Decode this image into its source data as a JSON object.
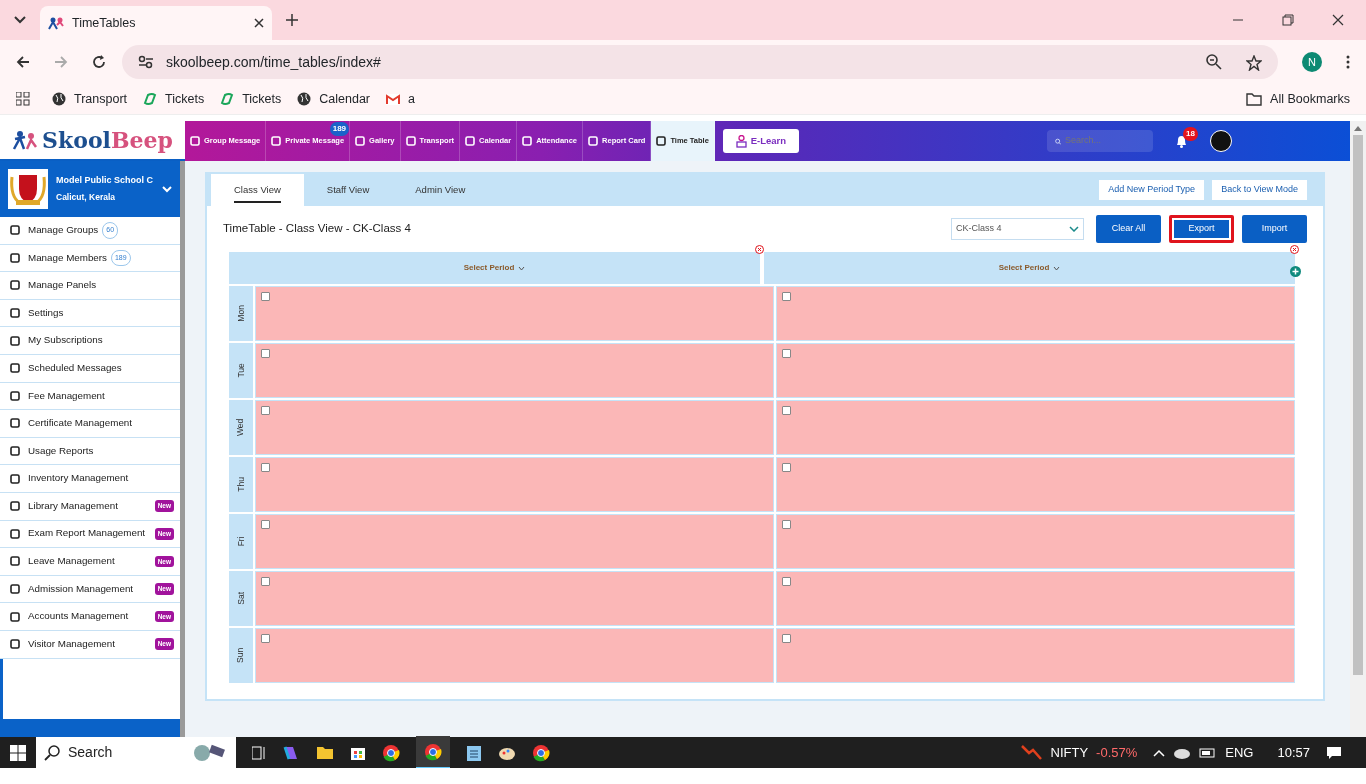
{
  "browser": {
    "tab_title": "TimeTables",
    "url": "skoolbeep.com/time_tables/index#",
    "profile_initial": "N",
    "all_bookmarks": "All Bookmarks",
    "bookmarks": [
      {
        "label": "Transport",
        "kind": "globe"
      },
      {
        "label": "Tickets",
        "kind": "ticket"
      },
      {
        "label": "Tickets",
        "kind": "ticket"
      },
      {
        "label": "Calendar",
        "kind": "globe"
      },
      {
        "label": "a",
        "kind": "mail"
      }
    ]
  },
  "header": {
    "logo_first": "Skool",
    "logo_second": "Beep",
    "elearn": "E-Learn",
    "search": {
      "placeholder": "Search..."
    },
    "notifications": "18",
    "nav": [
      {
        "label": "Group Message",
        "selected": false
      },
      {
        "label": "Private Message",
        "selected": false,
        "badge": "189"
      },
      {
        "label": "Gallery",
        "selected": false
      },
      {
        "label": "Transport",
        "selected": false
      },
      {
        "label": "Calendar",
        "selected": false
      },
      {
        "label": "Attendance",
        "selected": false
      },
      {
        "label": "Report Card",
        "selected": false
      },
      {
        "label": "Time Table",
        "selected": true
      }
    ]
  },
  "sidebar": {
    "school": "Model Public School C",
    "location": "Calicut, Kerala",
    "items": [
      {
        "label": "Manage Groups",
        "count": "60"
      },
      {
        "label": "Manage Members",
        "count": "189"
      },
      {
        "label": "Manage Panels"
      },
      {
        "label": "Settings"
      },
      {
        "label": "My Subscriptions"
      },
      {
        "label": "Scheduled Messages"
      },
      {
        "label": "Fee Management"
      },
      {
        "label": "Certificate Management"
      },
      {
        "label": "Usage Reports"
      },
      {
        "label": "Inventory Management"
      },
      {
        "label": "Library Management",
        "tag": "New"
      },
      {
        "label": "Exam Report Management",
        "tag": "New"
      },
      {
        "label": "Leave Management",
        "tag": "New"
      },
      {
        "label": "Admission Management",
        "tag": "New"
      },
      {
        "label": "Accounts Management",
        "tag": "New"
      },
      {
        "label": "Visitor Management",
        "tag": "New"
      }
    ]
  },
  "timetable": {
    "tabs": [
      {
        "label": "Class View",
        "selected": true
      },
      {
        "label": "Staff View",
        "selected": false
      },
      {
        "label": "Admin View",
        "selected": false
      }
    ],
    "actions": [
      "Add New Period Type",
      "Back to View Mode"
    ],
    "title": "TimeTable - Class View - CK-Class 4",
    "class_select": "CK-Class 4",
    "buttons": [
      {
        "label": "Clear All",
        "highlighted": false
      },
      {
        "label": "Export",
        "highlighted": true
      },
      {
        "label": "Import",
        "highlighted": false
      }
    ],
    "columns": [
      {
        "label": "Select Period"
      },
      {
        "label": "Select Period"
      }
    ],
    "rows": [
      {
        "day": "Mon",
        "cells": [
          {
            "checked": false
          },
          {
            "checked": false
          }
        ]
      },
      {
        "day": "Tue",
        "cells": [
          {
            "checked": false
          },
          {
            "checked": false
          }
        ]
      },
      {
        "day": "Wed",
        "cells": [
          {
            "checked": false
          },
          {
            "checked": false
          }
        ]
      },
      {
        "day": "Thu",
        "cells": [
          {
            "checked": false
          },
          {
            "checked": false
          }
        ]
      },
      {
        "day": "Fri",
        "cells": [
          {
            "checked": false
          },
          {
            "checked": false
          }
        ]
      },
      {
        "day": "Sat",
        "cells": [
          {
            "checked": false
          },
          {
            "checked": false
          }
        ]
      },
      {
        "day": "Sun",
        "cells": [
          {
            "checked": false
          },
          {
            "checked": false
          }
        ]
      }
    ]
  },
  "taskbar": {
    "search": "Search",
    "ticker": "NIFTY",
    "change": "-0.57%",
    "language": "ENG",
    "time": "10:57"
  }
}
